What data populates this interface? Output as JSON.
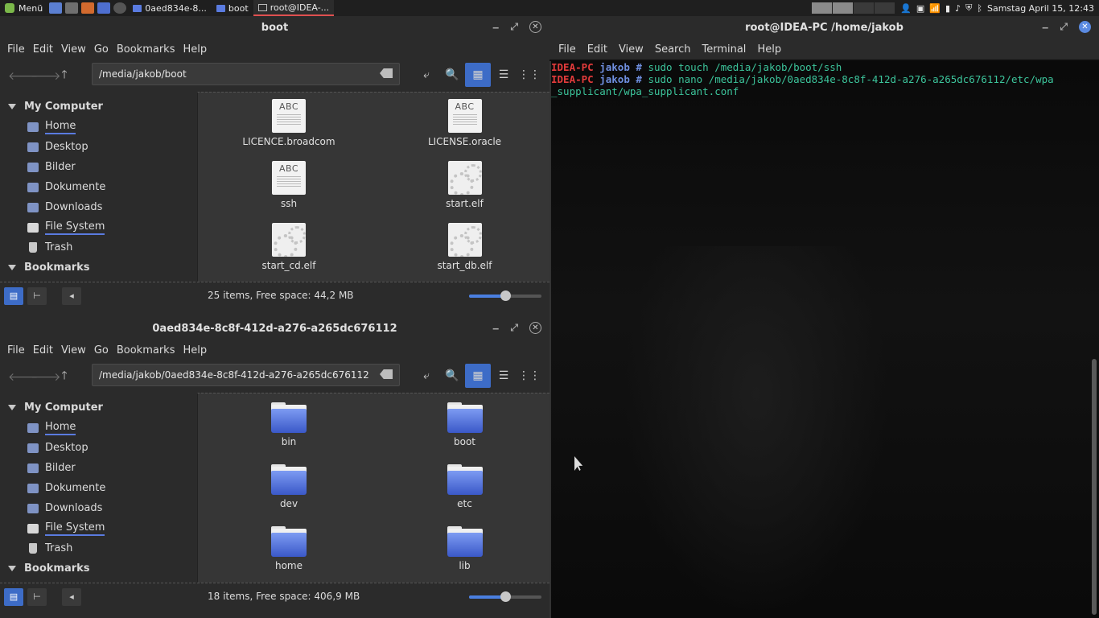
{
  "panel": {
    "menu_label": "Menü",
    "tasks": [
      {
        "label": "0aed834e-8..."
      },
      {
        "label": "boot"
      },
      {
        "label": "root@IDEA-..."
      }
    ],
    "clock": "Samstag April 15, 12:43"
  },
  "fm1": {
    "title": "boot",
    "menu": [
      "File",
      "Edit",
      "View",
      "Go",
      "Bookmarks",
      "Help"
    ],
    "path": "/media/jakob/boot",
    "sidebar": {
      "my_computer": "My Computer",
      "items": [
        "Home",
        "Desktop",
        "Bilder",
        "Dokumente",
        "Downloads",
        "File System",
        "Trash"
      ],
      "bookmarks": "Bookmarks"
    },
    "files": [
      {
        "name": "LICENCE.broadcom",
        "abc": "ABC"
      },
      {
        "name": "LICENSE.oracle",
        "abc": "ABC"
      },
      {
        "name": "ssh",
        "abc": "ABC"
      },
      {
        "name": "start.elf"
      },
      {
        "name": "start_cd.elf"
      },
      {
        "name": "start_db.elf"
      }
    ],
    "status": "25 items, Free space: 44,2 MB",
    "zoom": 0.5
  },
  "fm2": {
    "title": "0aed834e-8c8f-412d-a276-a265dc676112",
    "menu": [
      "File",
      "Edit",
      "View",
      "Go",
      "Bookmarks",
      "Help"
    ],
    "path": "/media/jakob/0aed834e-8c8f-412d-a276-a265dc676112",
    "sidebar": {
      "my_computer": "My Computer",
      "items": [
        "Home",
        "Desktop",
        "Bilder",
        "Dokumente",
        "Downloads",
        "File System",
        "Trash"
      ],
      "bookmarks": "Bookmarks"
    },
    "folders": [
      "bin",
      "boot",
      "dev",
      "etc",
      "home",
      "lib"
    ],
    "status": "18 items, Free space: 406,9 MB",
    "zoom": 0.5
  },
  "terminal": {
    "title": "root@IDEA-PC /home/jakob",
    "menu": [
      "File",
      "Edit",
      "View",
      "Search",
      "Terminal",
      "Help"
    ],
    "lines": [
      {
        "host": "IDEA-PC",
        "user": "jakob",
        "prompt": "#",
        "cmd": "sudo touch /media/jakob/boot/ssh"
      },
      {
        "host": "IDEA-PC",
        "user": "jakob",
        "prompt": "#",
        "cmd": "sudo nano /media/jakob/0aed834e-8c8f-412d-a276-a265dc676112/etc/wpa"
      }
    ],
    "wrap": "_supplicant/wpa_supplicant.conf"
  }
}
